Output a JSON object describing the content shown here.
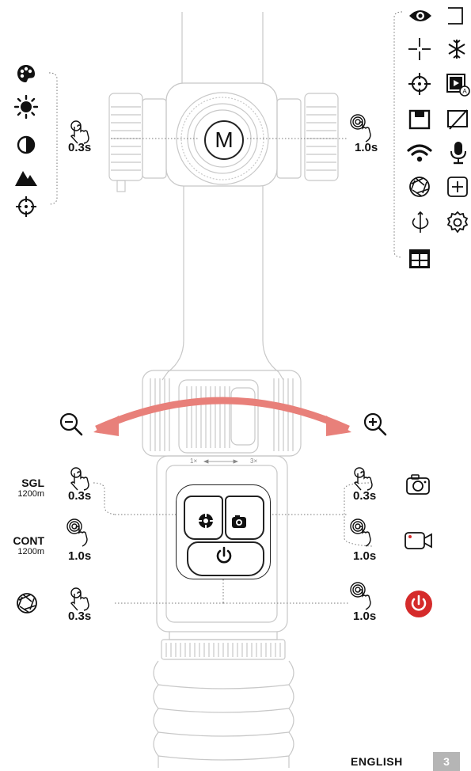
{
  "m_button": {
    "label": "M"
  },
  "top_controls": {
    "short_press": "0.3s",
    "long_press": "1.0s",
    "left_menu_icons": [
      "palette-icon",
      "brightness-icon",
      "contrast-icon",
      "scene-mode-icon",
      "reticle-icon"
    ],
    "right_menu_icons": [
      "eye-icon",
      "rangefinder-bracket-icon",
      "crosshair-icon",
      "freeze-icon",
      "zeroing-icon",
      "pip-icon",
      "display-icon",
      "display-off-icon",
      "wifi-icon",
      "microphone-icon",
      "shutter-icon",
      "plus-box-icon",
      "rotate-icon",
      "settings-gear-icon",
      "grid-layout-icon"
    ]
  },
  "zoom": {
    "min_label": "1×",
    "max_label": "3×"
  },
  "bottom_controls": {
    "rangefinder_single": {
      "mode": "SGL",
      "distance": "1200m",
      "press": "0.3s"
    },
    "rangefinder_continuous": {
      "mode": "CONT",
      "distance": "1200m",
      "press": "1.0s"
    },
    "shutter": {
      "press": "0.3s"
    },
    "photo": {
      "press": "0.3s"
    },
    "video": {
      "press": "1.0s"
    },
    "power": {
      "press": "1.0s"
    }
  },
  "colors": {
    "arrow": "#e8807a",
    "power_red": "#d52b2b",
    "line": "#c9c9c9"
  },
  "footer": {
    "language": "ENGLISH",
    "page": "3"
  }
}
